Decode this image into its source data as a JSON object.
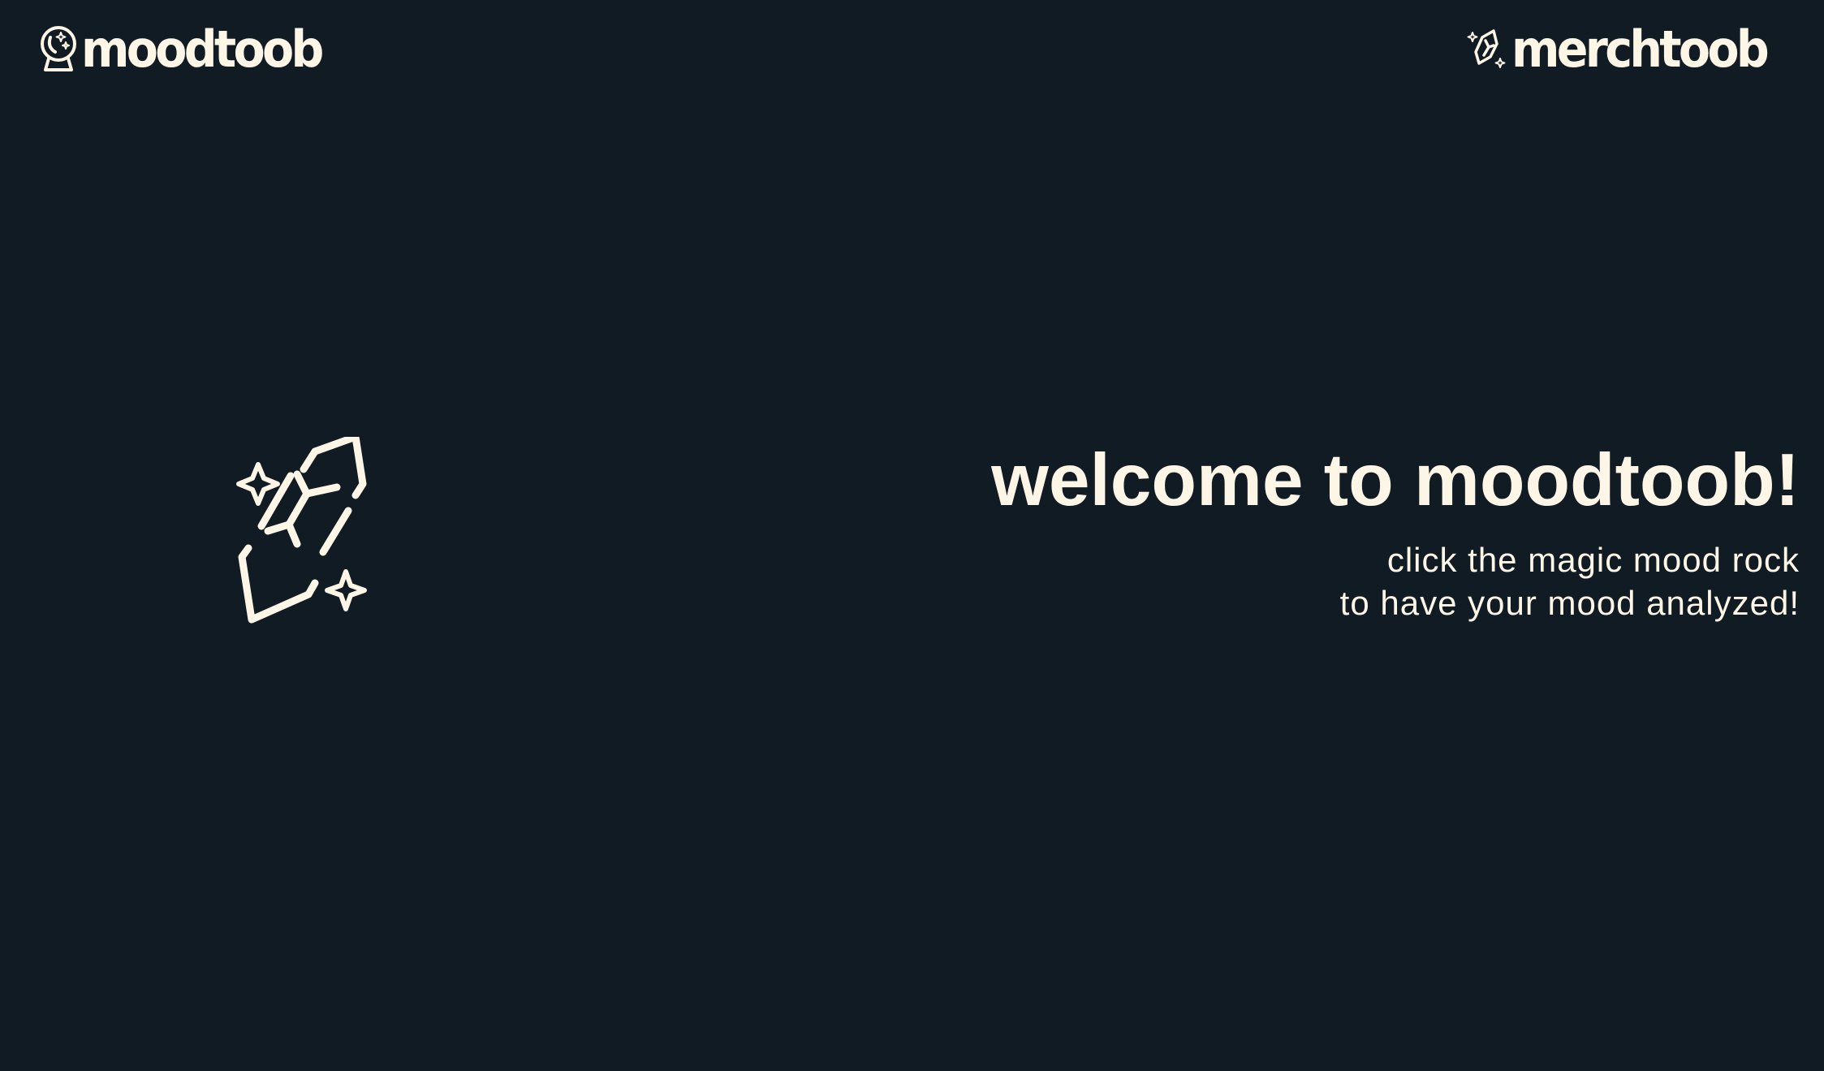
{
  "header": {
    "left_brand": {
      "text": "moodtoob",
      "icon": "crystal-ball-icon"
    },
    "right_brand": {
      "text": "merchtoob",
      "icon": "crystal-rock-icon"
    }
  },
  "hero": {
    "rock_icon": "magic-mood-rock-icon",
    "title": "welcome to moodtoob!",
    "subtitle_line1": "click the magic mood rock",
    "subtitle_line2": "to have your mood analyzed!"
  },
  "colors": {
    "background": "#111b24",
    "foreground": "#fdf6e6"
  }
}
